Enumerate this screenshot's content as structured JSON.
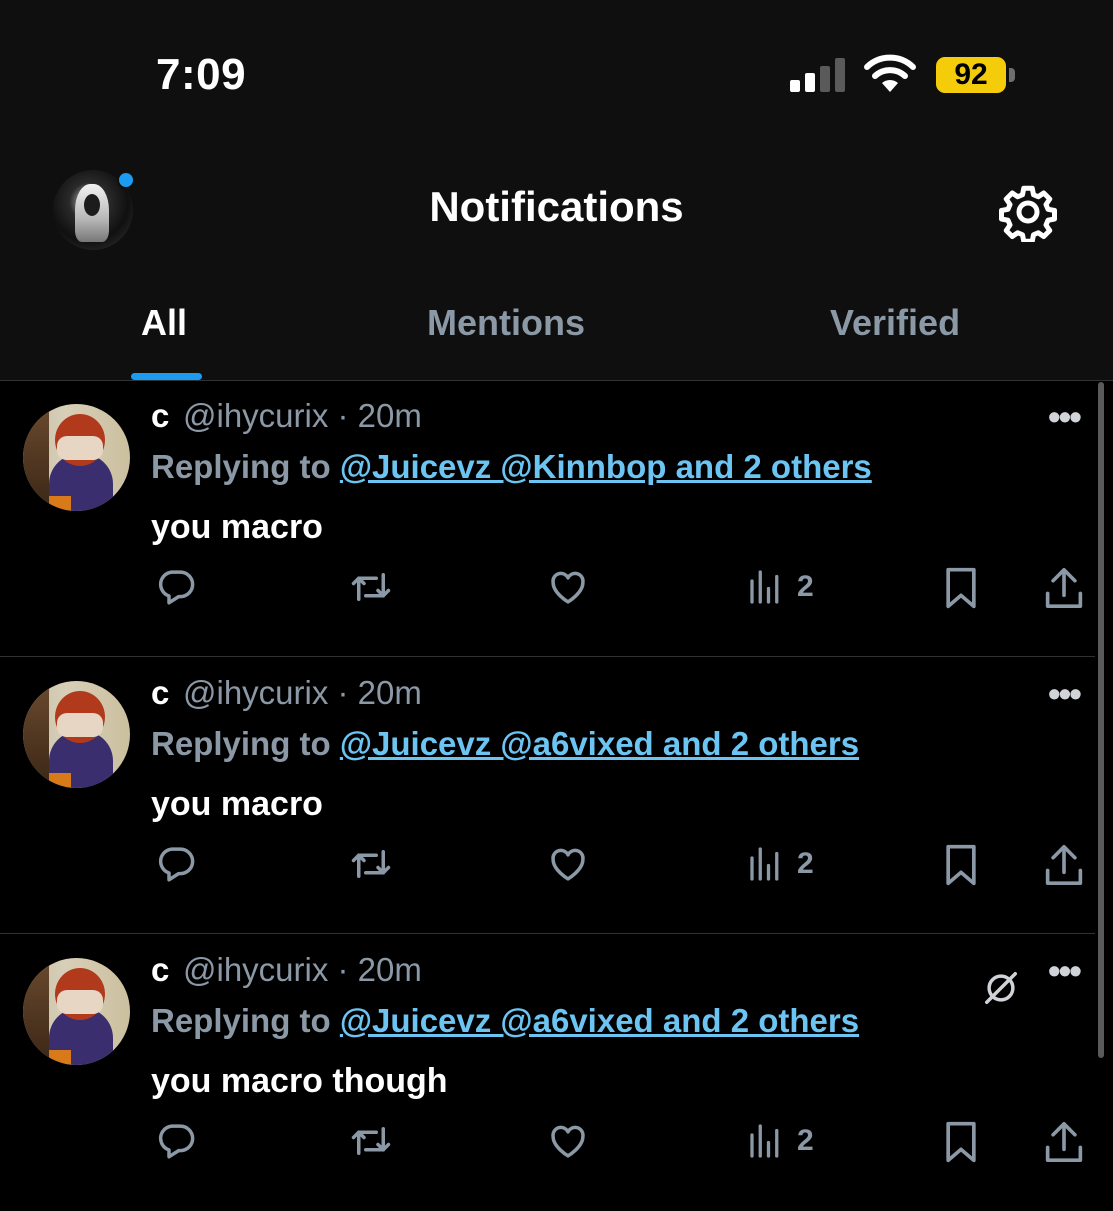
{
  "status_bar": {
    "time": "7:09",
    "battery": "92"
  },
  "header": {
    "title": "Notifications"
  },
  "tabs": [
    {
      "label": "All",
      "active": true
    },
    {
      "label": "Mentions",
      "active": false
    },
    {
      "label": "Verified",
      "active": false
    }
  ],
  "tweets": [
    {
      "name": "c",
      "handle_time": "@ihycurix · 20m",
      "reply_prefix": "Replying to ",
      "reply_targets": "@Juicevz @Kinnbop and 2 others",
      "text": "you macro",
      "views": "2",
      "muted_indicator": false
    },
    {
      "name": "c",
      "handle_time": "@ihycurix · 20m",
      "reply_prefix": "Replying to ",
      "reply_targets": "@Juicevz @a6vixed and 2 others",
      "text": "you macro",
      "views": "2",
      "muted_indicator": false
    },
    {
      "name": "c",
      "handle_time": "@ihycurix · 20m",
      "reply_prefix": "Replying to ",
      "reply_targets": "@Juicevz @a6vixed and 2 others",
      "text": "you macro though",
      "views": "2",
      "muted_indicator": true
    }
  ],
  "icons": [
    "gear-icon",
    "reply-icon",
    "retweet-icon",
    "like-icon",
    "views-icon",
    "bookmark-icon",
    "share-icon",
    "more-icon",
    "grok-icon"
  ],
  "colors": {
    "accent": "#1d9bf0",
    "link": "#6cc4f2",
    "muted_text": "#8b98a5",
    "battery": "#f5cc0a"
  }
}
